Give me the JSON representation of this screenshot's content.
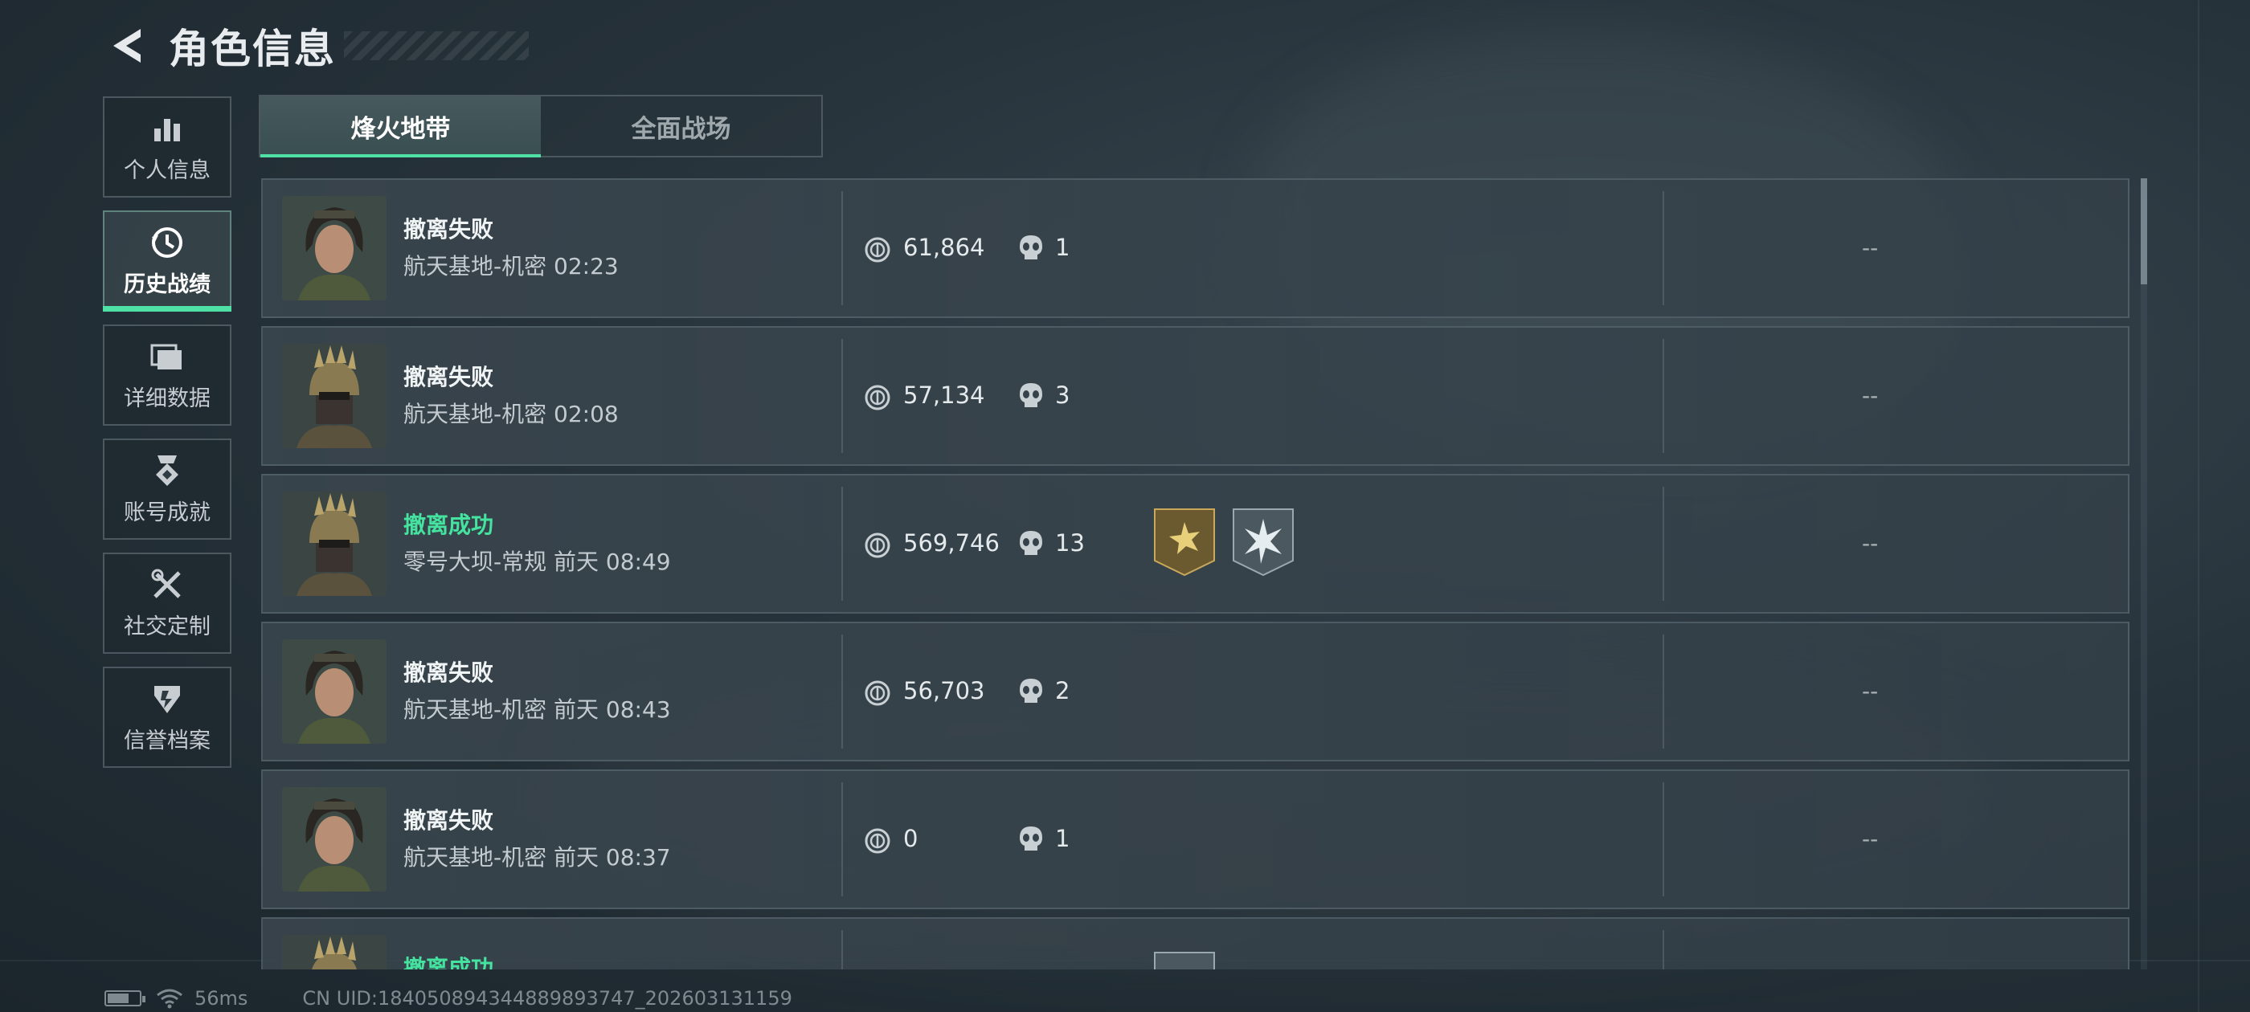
{
  "header": {
    "title": "角色信息"
  },
  "sidebar": {
    "items": [
      {
        "label": "个人信息",
        "icon": "bar-chart-icon",
        "active": false
      },
      {
        "label": "历史战绩",
        "icon": "history-clock-icon",
        "active": true
      },
      {
        "label": "详细数据",
        "icon": "folders-icon",
        "active": false
      },
      {
        "label": "账号成就",
        "icon": "medal-icon",
        "active": false
      },
      {
        "label": "社交定制",
        "icon": "tools-icon",
        "active": false
      },
      {
        "label": "信誉档案",
        "icon": "shield-badge-icon",
        "active": false
      }
    ]
  },
  "tabs": [
    {
      "label": "烽火地带",
      "active": true
    },
    {
      "label": "全面战场",
      "active": false
    }
  ],
  "matches": [
    {
      "result": "撤离失败",
      "success": false,
      "map": "航天基地-机密 02:23",
      "value": "61,864",
      "kills": "1",
      "badges": [],
      "extra": "--",
      "avatar": "female-operator"
    },
    {
      "result": "撤离失败",
      "success": false,
      "map": "航天基地-机密 02:08",
      "value": "57,134",
      "kills": "3",
      "badges": [],
      "extra": "--",
      "avatar": "helmet-operator"
    },
    {
      "result": "撤离成功",
      "success": true,
      "map": "零号大坝-常规 前天 08:49",
      "value": "569,746",
      "kills": "13",
      "badges": [
        "gold-sun-badge",
        "silver-burst-badge"
      ],
      "extra": "--",
      "avatar": "helmet-operator"
    },
    {
      "result": "撤离失败",
      "success": false,
      "map": "航天基地-机密 前天 08:43",
      "value": "56,703",
      "kills": "2",
      "badges": [],
      "extra": "--",
      "avatar": "female-operator"
    },
    {
      "result": "撤离失败",
      "success": false,
      "map": "航天基地-机密 前天 08:37",
      "value": "0",
      "kills": "1",
      "badges": [],
      "extra": "--",
      "avatar": "female-operator"
    },
    {
      "result": "撤离成功",
      "success": true,
      "map": "",
      "value": "",
      "kills": "",
      "badges": [
        "silver-partial-badge"
      ],
      "extra": "",
      "avatar": "helmet-operator"
    }
  ],
  "footer": {
    "ping": "56ms",
    "uid": "CN UID:18405089434488989​3747_202603131159"
  },
  "colors": {
    "accent": "#4fe0a6",
    "success": "#45e3a0"
  }
}
